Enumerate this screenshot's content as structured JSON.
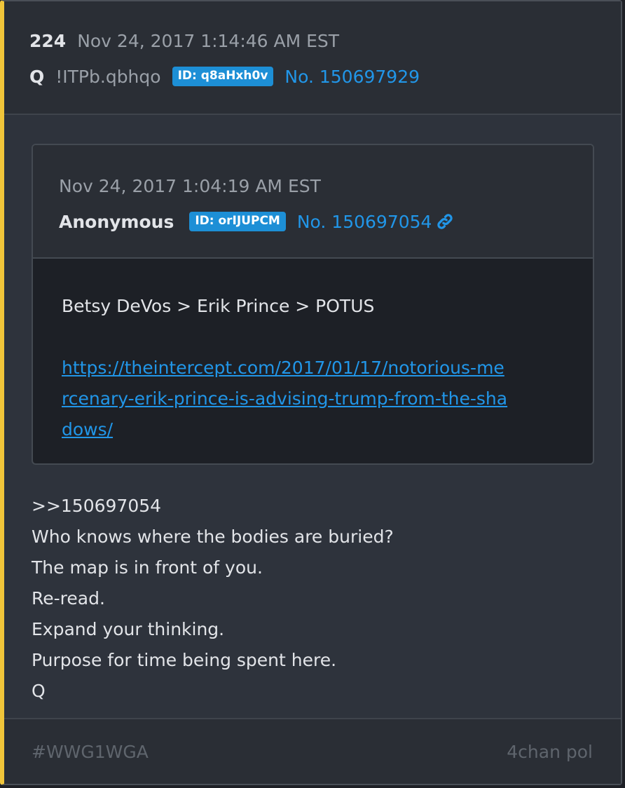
{
  "post": {
    "number": "224",
    "timestamp": "Nov 24, 2017 1:14:46 AM EST",
    "author": "Q",
    "tripcode": "!ITPb.qbhqo",
    "id_badge": "ID: q8aHxh0v",
    "post_id": "No. 150697929"
  },
  "quoted_post": {
    "timestamp": "Nov 24, 2017 1:04:19 AM EST",
    "author": "Anonymous",
    "id_badge": "ID: orIJUPCM",
    "post_id": "No. 150697054",
    "text": "Betsy DeVos > Erik Prince > POTUS",
    "url": "https://theintercept.com/2017/01/17/notorious-mercenary-erik-prince-is-advising-trump-from-the-shadows/"
  },
  "body_lines": [
    ">>150697054",
    "Who knows where the bodies are buried?",
    "The map is in front of you.",
    "Re-read.",
    "Expand your thinking.",
    "Purpose for time being spent here.",
    "Q"
  ],
  "footer": {
    "hashtag": "#WWG1WGA",
    "source": "4chan pol"
  },
  "icons": {
    "link": "link-icon"
  },
  "colors": {
    "accent_bar": "#f0c53a",
    "badge": "#1d8fd6",
    "link": "#2196e8"
  }
}
